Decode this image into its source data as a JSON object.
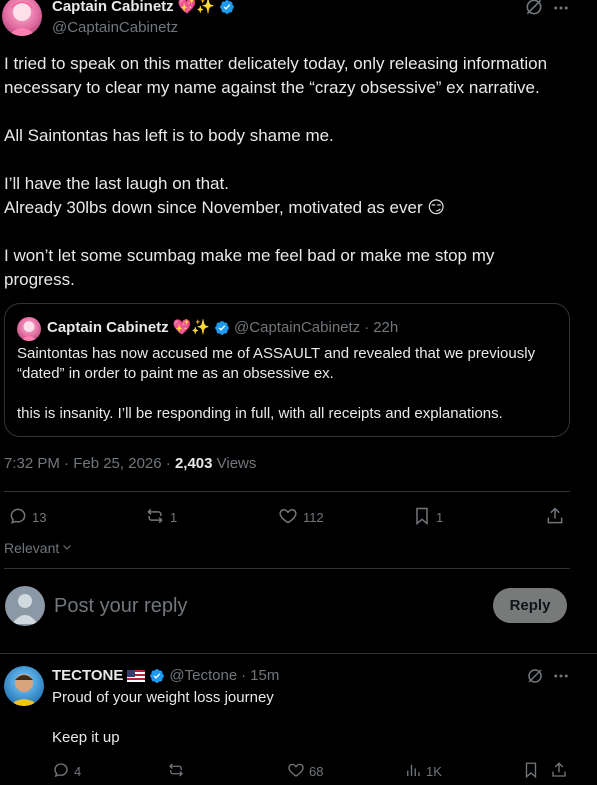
{
  "post": {
    "author_name": "Captain Cabinetz",
    "author_emojis": "💖✨",
    "author_handle": "@CaptainCabinetz",
    "body_lines": [
      "I tried to speak on this matter delicately today, only releasing information",
      "necessary to clear my name against the “crazy obsessive” ex narrative.",
      "",
      "All Saintontas has left is to body shame me.",
      "",
      "I’ll have the last laugh on that.",
      "Already 30lbs down since November, motivated as ever 😏",
      "",
      "I won’t let some scumbag make me feel bad or make me stop my",
      "progress."
    ],
    "quote": {
      "author_name": "Captain Cabinetz",
      "author_emojis": "💖✨",
      "author_handle": "@CaptainCabinetz",
      "time": "22h",
      "body_lines": [
        "Saintontas has now accused me of ASSAULT and revealed that we previously",
        "“dated” in order to paint me as an obsessive ex.",
        "",
        "this is insanity. I’ll be responding in full, with all receipts and explanations."
      ]
    },
    "timestamp": "7:32 PM · Feb 25, 2026 · ",
    "views_count": "2,403",
    "views_label": " Views",
    "actions": {
      "replies": "13",
      "reposts": "1",
      "likes": "112",
      "bookmarks": "1"
    }
  },
  "sort": {
    "label": "Relevant"
  },
  "composer": {
    "placeholder": "Post your reply",
    "reply_button": "Reply"
  },
  "reply": {
    "author_name": "TECTONE",
    "author_flag": "🇺🇸",
    "author_handle": "@Tectone",
    "time": "15m",
    "body_lines": [
      "Proud of your weight loss journey",
      "",
      "Keep it up"
    ],
    "actions": {
      "replies": "4",
      "reposts": "",
      "likes": "68",
      "views": "1K"
    }
  },
  "colors": {
    "background": "#000000",
    "text": "#e7e9ea",
    "muted": "#71767b",
    "verified": "#1d9bf0",
    "border": "#2f3336"
  }
}
